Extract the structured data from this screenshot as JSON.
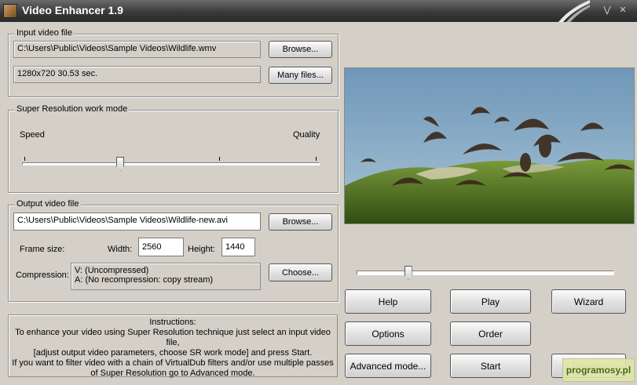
{
  "window": {
    "title": "Video Enhancer 1.9"
  },
  "input": {
    "group_title": "Input video file",
    "path": "C:\\Users\\Public\\Videos\\Sample Videos\\Wildlife.wmv",
    "info": "1280x720 30.53 sec.",
    "browse_label": "Browse...",
    "many_files_label": "Many files..."
  },
  "sr_mode": {
    "group_title": "Super Resolution work mode",
    "left_label": "Speed",
    "right_label": "Quality",
    "slider_value": 0.33
  },
  "output": {
    "group_title": "Output video file",
    "path": "C:\\Users\\Public\\Videos\\Sample Videos\\Wildlife-new.avi",
    "browse_label": "Browse...",
    "frame_size_label": "Frame size:",
    "width_label": "Width:",
    "width_value": "2560",
    "height_label": "Height:",
    "height_value": "1440",
    "compression_label": "Compression:",
    "compression_v": "V: (Uncompressed)",
    "compression_a": "A: (No recompression: copy stream)",
    "choose_label": "Choose..."
  },
  "instructions": {
    "title": "Instructions:",
    "line1": "To enhance your video using Super Resolution technique just select an input video file,",
    "line2": "[adjust output video parameters, choose SR work mode] and press Start.",
    "line3": "If you want to filter video with a chain of VirtualDub filters and/or use multiple passes",
    "line4": "of Super Resolution go to Advanced mode."
  },
  "seek": {
    "value": 0.2
  },
  "buttons": {
    "help": "Help",
    "play": "Play",
    "wizard": "Wizard",
    "options": "Options",
    "order": "Order",
    "advanced": "Advanced mode...",
    "start": "Start",
    "preview": "Preview"
  },
  "watermark": {
    "text": "programosy.pl"
  },
  "icons": [
    "app-icon",
    "chevron-down-icon",
    "close-icon"
  ]
}
